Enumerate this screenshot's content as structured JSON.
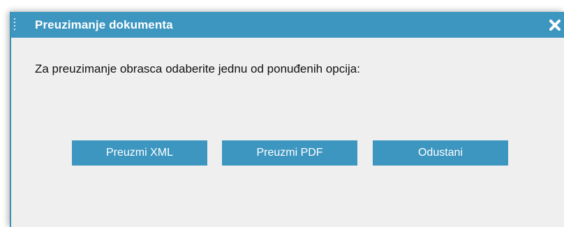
{
  "dialog": {
    "title": "Preuzimanje dokumenta",
    "message": "Za preuzimanje obrasca odaberite jednu od ponuđenih opcija:",
    "buttons": {
      "xml": "Preuzmi XML",
      "pdf": "Preuzmi PDF",
      "cancel": "Odustani"
    },
    "close_icon": "close-icon"
  },
  "colors": {
    "accent": "#3d96c0",
    "background": "#efefef",
    "text": "#111111"
  }
}
